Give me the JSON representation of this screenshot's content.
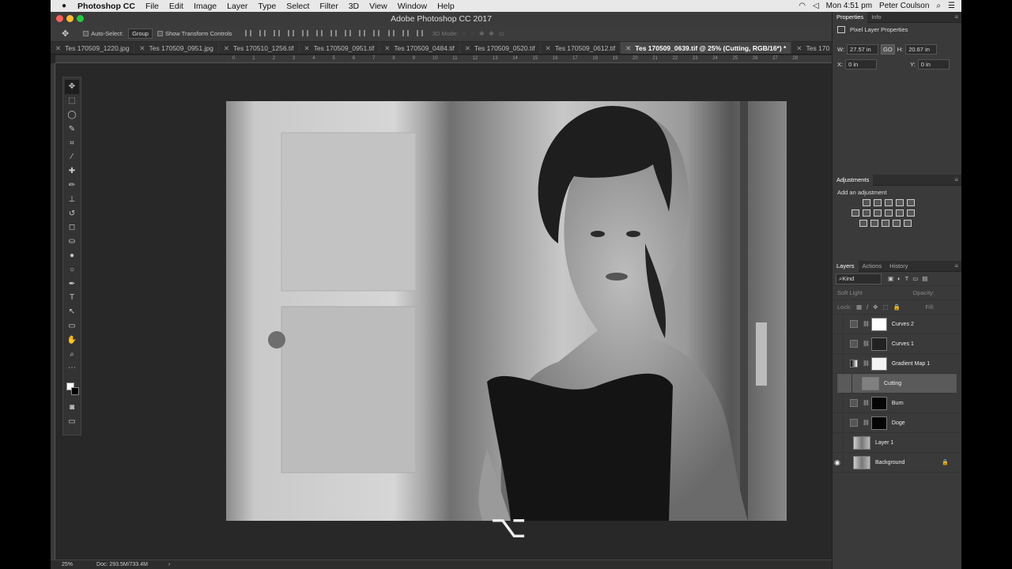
{
  "app": {
    "name": "Photoshop CC",
    "window_title": "Adobe Photoshop CC 2017"
  },
  "menu": [
    "File",
    "Edit",
    "Image",
    "Layer",
    "Type",
    "Select",
    "Filter",
    "3D",
    "View",
    "Window",
    "Help"
  ],
  "system": {
    "clock": "Mon 4:51 pm",
    "user": "Peter Coulson"
  },
  "options": {
    "auto_select": "Auto-Select:",
    "group": "Group",
    "show_transform": "Show Transform Controls",
    "mode_3d": "3D Mode:"
  },
  "tabs": [
    {
      "label": "Tes 170509_1220.jpg"
    },
    {
      "label": "Tes 170509_0951.jpg"
    },
    {
      "label": "Tes 170510_1256.tif"
    },
    {
      "label": "Tes 170509_0951.tif"
    },
    {
      "label": "Tes 170509_0484.tif"
    },
    {
      "label": "Tes 170509_0520.tif"
    },
    {
      "label": "Tes 170509_0612.tif"
    },
    {
      "label": "Tes 170509_0639.tif @ 25% (Cutting, RGB/16*) *"
    },
    {
      "label": "Tes 170"
    }
  ],
  "ruler": [
    "0",
    "1",
    "2",
    "3",
    "4",
    "5",
    "6",
    "7",
    "8",
    "9",
    "10",
    "11",
    "12",
    "13",
    "14",
    "15",
    "16",
    "17",
    "18",
    "19",
    "20",
    "21",
    "22",
    "23",
    "24",
    "25",
    "26",
    "27",
    "28"
  ],
  "tools": [
    "move-icon",
    "marquee-icon",
    "lasso-icon",
    "quick-select-icon",
    "crop-icon",
    "eyedropper-icon",
    "healing-icon",
    "brush-icon",
    "stamp-icon",
    "history-brush-icon",
    "eraser-icon",
    "bucket-icon",
    "blur-icon",
    "dodge-icon",
    "pen-icon",
    "type-icon",
    "path-select-icon",
    "rectangle-icon",
    "hand-icon",
    "zoom-icon",
    "more-icon"
  ],
  "overlay_key": "⌥",
  "status": {
    "zoom": "25%",
    "doc": "Doc: 293.5M/733.4M"
  },
  "properties": {
    "tabs": [
      "Properties",
      "Info"
    ],
    "title": "Pixel Layer Properties",
    "w_label": "W:",
    "w": "27.57 in",
    "link": "GO",
    "h_label": "H:",
    "h": "20.67 in",
    "x_label": "X:",
    "x": "0 in",
    "y_label": "Y:",
    "y": "0 in"
  },
  "adjustments": {
    "title": "Adjustments",
    "subtitle": "Add an adjustment"
  },
  "layers_panel": {
    "tabs": [
      "Layers",
      "Actions",
      "History"
    ],
    "filter": "Kind",
    "blend": "Soft Light",
    "opacity_label": "Opacity:",
    "lock_label": "Lock:",
    "fill_label": "Fill:",
    "layers": [
      {
        "name": "Curves 2",
        "type": "adjust",
        "mask": "#fff"
      },
      {
        "name": "Curves 1",
        "type": "adjust",
        "mask": "#222"
      },
      {
        "name": "Gradient Map 1",
        "type": "gradient",
        "mask": "#f2f2f2"
      },
      {
        "name": "Cutting",
        "type": "pixel",
        "selected": true
      },
      {
        "name": "Burn",
        "type": "adjust",
        "mask": "#050505"
      },
      {
        "name": "Doge",
        "type": "adjust",
        "mask": "#050505"
      },
      {
        "name": "Layer 1",
        "type": "pixel"
      },
      {
        "name": "Background",
        "type": "pixel",
        "locked": true,
        "visible": true
      }
    ]
  }
}
